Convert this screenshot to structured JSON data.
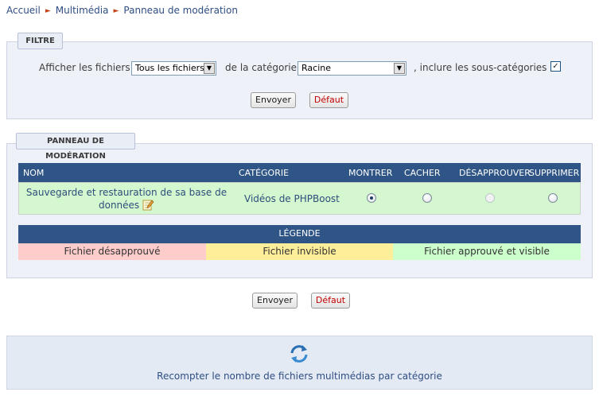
{
  "breadcrumb": {
    "items": [
      "Accueil",
      "Multimédia",
      "Panneau de modération"
    ],
    "separator": "►"
  },
  "filter": {
    "legend": "FILTRE",
    "show_label": "Afficher les fichiers",
    "files_select_value": "Tous les fichiers",
    "category_label": "de la catégorie",
    "category_select_value": "Racine",
    "subcat_label": ", inclure les sous-catégories :",
    "subcat_checked": true,
    "submit_label": "Envoyer",
    "reset_label": "Défaut"
  },
  "moderation": {
    "legend": "PANNEAU DE MODÉRATION",
    "columns": {
      "name": "NOM",
      "category": "CATÉGORIE",
      "show": "MONTRER",
      "hide": "CACHER",
      "disapprove": "DÉSAPPROUVER",
      "delete": "SUPPRIMER"
    },
    "rows": [
      {
        "name_line1": "Sauvegarde et restauration de sa base de",
        "name_line2": "données",
        "category": "Vidéos de PHPBoost",
        "selected_action": "show",
        "row_color": "#d5f7cf"
      }
    ],
    "legend_title": "LÉGENDE",
    "legend_items": [
      {
        "label": "Fichier désapprouvé",
        "color": "#ffcccc"
      },
      {
        "label": "Fichier invisible",
        "color": "#ffee99"
      },
      {
        "label": "Fichier approuvé et visible",
        "color": "#ccffcc"
      }
    ]
  },
  "actions": {
    "submit_label": "Envoyer",
    "reset_label": "Défaut"
  },
  "recount": {
    "icon": "refresh-icon",
    "label": "Recompter le nombre de fichiers multimédias par catégorie"
  },
  "colors": {
    "header_blue": "#2f5587",
    "link_blue": "#2f4d82",
    "breadcrumb_arrow": "#c1451b",
    "reset_red": "#c00000"
  }
}
